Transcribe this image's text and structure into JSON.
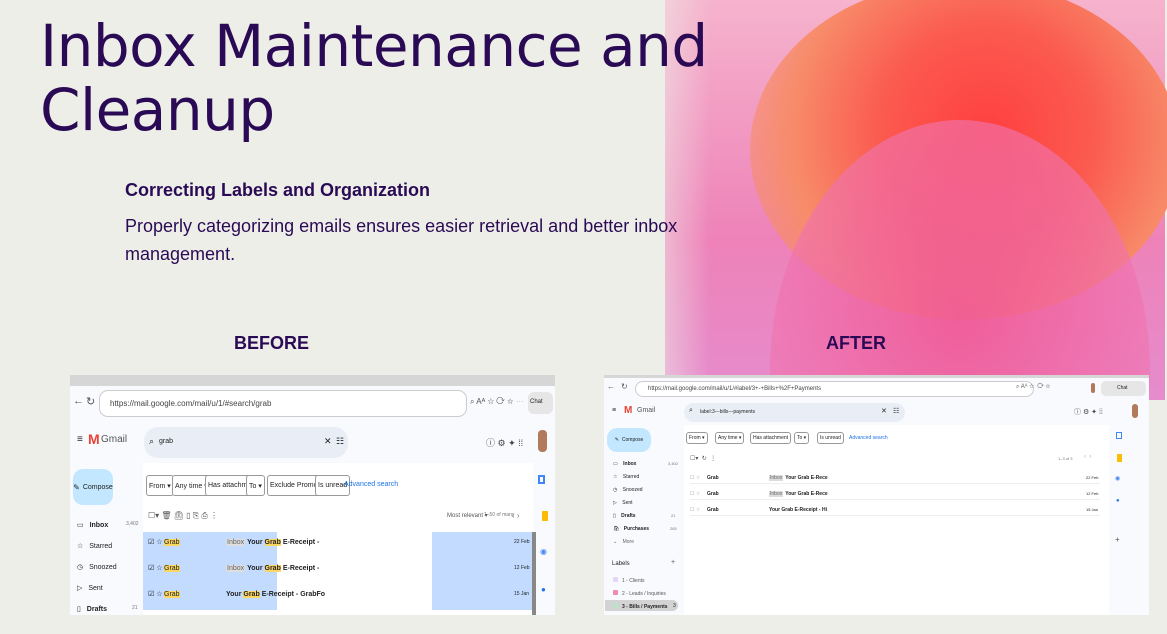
{
  "slide": {
    "title_line1": "Inbox Maintenance and",
    "title_line2": "Cleanup",
    "subtitle": "Correcting Labels and Organization",
    "body": "Properly categorizing emails ensures easier retrieval and better inbox management.",
    "before_label": "BEFORE",
    "after_label": "AFTER"
  },
  "before": {
    "url": "https://mail.google.com/mail/u/1/#search/grab",
    "app": "Gmail",
    "search": "grab",
    "compose": "Compose",
    "chips": [
      "From ▾",
      "Any time ▾",
      "Has attachment",
      "To ▾",
      "Exclude Promotions",
      "Is unread"
    ],
    "advanced": "Advanced search",
    "sort": "Most relevant ▾",
    "range": "1–50 of many",
    "nav": [
      {
        "label": "Inbox",
        "count": "3,402"
      },
      {
        "label": "Starred",
        "count": ""
      },
      {
        "label": "Snoozed",
        "count": ""
      },
      {
        "label": "Sent",
        "count": ""
      },
      {
        "label": "Drafts",
        "count": "21"
      }
    ],
    "rows": [
      {
        "sender": "Grab",
        "tag": "Inbox",
        "subject": "Your",
        "hl": "Grab",
        "rest": "E-Receipt -",
        "date": "22 Feb"
      },
      {
        "sender": "Grab",
        "tag": "Inbox",
        "subject": "Your",
        "hl": "Grab",
        "rest": "E-Receipt -",
        "date": "12 Feb"
      },
      {
        "sender": "Grab",
        "tag": "",
        "subject": "Your",
        "hl": "Grab",
        "rest": "E-Receipt - GrabFo",
        "date": "15 Jan"
      }
    ]
  },
  "after": {
    "url": "https://mail.google.com/mail/u/1/#label/3+-+Bills+%2F+Payments",
    "app": "Gmail",
    "search": "label:3---bills---payments",
    "compose": "Compose",
    "chat": "Chat",
    "chips": [
      "From ▾",
      "Any time ▾",
      "Has attachment",
      "To ▾",
      "Is unread"
    ],
    "advanced": "Advanced search",
    "range": "1–3 of 3",
    "nav": [
      {
        "label": "Inbox",
        "count": "3,402"
      },
      {
        "label": "Starred",
        "count": ""
      },
      {
        "label": "Snoozed",
        "count": ""
      },
      {
        "label": "Sent",
        "count": ""
      },
      {
        "label": "Drafts",
        "count": "21"
      },
      {
        "label": "Purchases",
        "count": "265"
      },
      {
        "label": "More",
        "count": ""
      }
    ],
    "labels_heading": "Labels",
    "labels": [
      {
        "label": "1 - Clients",
        "count": "",
        "color": "#e4d7f5"
      },
      {
        "label": "2 - Leads / Inquiries",
        "count": "",
        "color": "#f28ab0"
      },
      {
        "label": "3 - Bills / Payments",
        "count": "3",
        "color": "#b9e4c9"
      }
    ],
    "rows": [
      {
        "sender": "Grab",
        "tag": "Inbox",
        "subject": "Your Grab E-Rece",
        "date": "22 Feb"
      },
      {
        "sender": "Grab",
        "tag": "Inbox",
        "subject": "Your Grab E-Rece",
        "date": "12 Feb"
      },
      {
        "sender": "Grab",
        "tag": "",
        "subject": "Your Grab E-Receipt - Hi",
        "date": "15 Jan"
      }
    ]
  },
  "before_chat": "Chat"
}
